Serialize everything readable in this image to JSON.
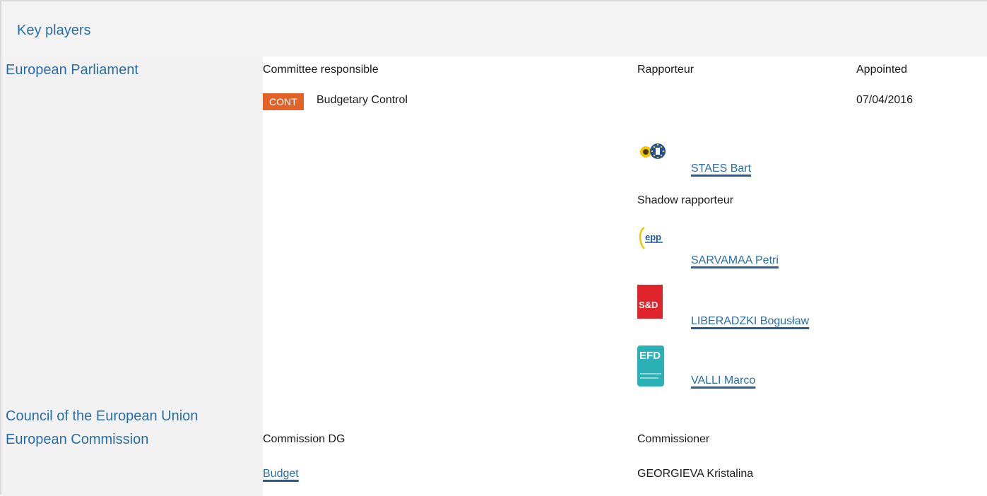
{
  "header": {
    "title": "Key players"
  },
  "institutions": {
    "ep": "European Parliament",
    "council": "Council of the European Union",
    "commission": "European Commission"
  },
  "ep_section": {
    "committee_label": "Committee responsible",
    "rapporteur_label": "Rapporteur",
    "appointed_label": "Appointed",
    "committee_badge": "CONT",
    "committee_name": "Budgetary Control",
    "appointed_date": "07/04/2016",
    "rapporteur": {
      "name": "STAES Bart",
      "group_icon": "greens-efa-logo"
    },
    "shadow_label": "Shadow rapporteur",
    "shadows": [
      {
        "name": "SARVAMAA Petri",
        "group_icon": "epp-logo"
      },
      {
        "name": "LIBERADZKI Bogusław",
        "group_icon": "s-and-d-logo",
        "logo_text": "S&D"
      },
      {
        "name": "VALLI Marco",
        "group_icon": "efd-logo",
        "logo_text": "EFD"
      }
    ]
  },
  "commission_section": {
    "dg_label": "Commission DG",
    "commissioner_label": "Commissioner",
    "dg_value": "Budget",
    "commissioner_value": "GEORGIEVA Kristalina"
  },
  "colors": {
    "link": "#2a6da6",
    "badge": "#e36227",
    "s_and_d": "#e0242b",
    "efd": "#2bb0b5",
    "greens": "#1e4fa0"
  }
}
